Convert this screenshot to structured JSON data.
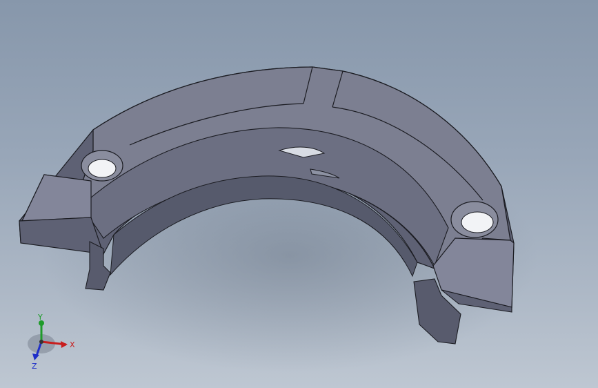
{
  "viewport": {
    "background_top": "#8797ab",
    "background_bottom": "#bec7d2"
  },
  "model": {
    "description_icon": "half-ring-clamp-part",
    "face_color": "#7b7e90",
    "side_color": "#5d6072",
    "edge_color": "#1b1c22"
  },
  "triad": {
    "x_label": "X",
    "y_label": "Y",
    "z_label": "Z",
    "x_color": "#c81e1e",
    "y_color": "#1e9b2a",
    "z_color": "#1e2fc8"
  }
}
